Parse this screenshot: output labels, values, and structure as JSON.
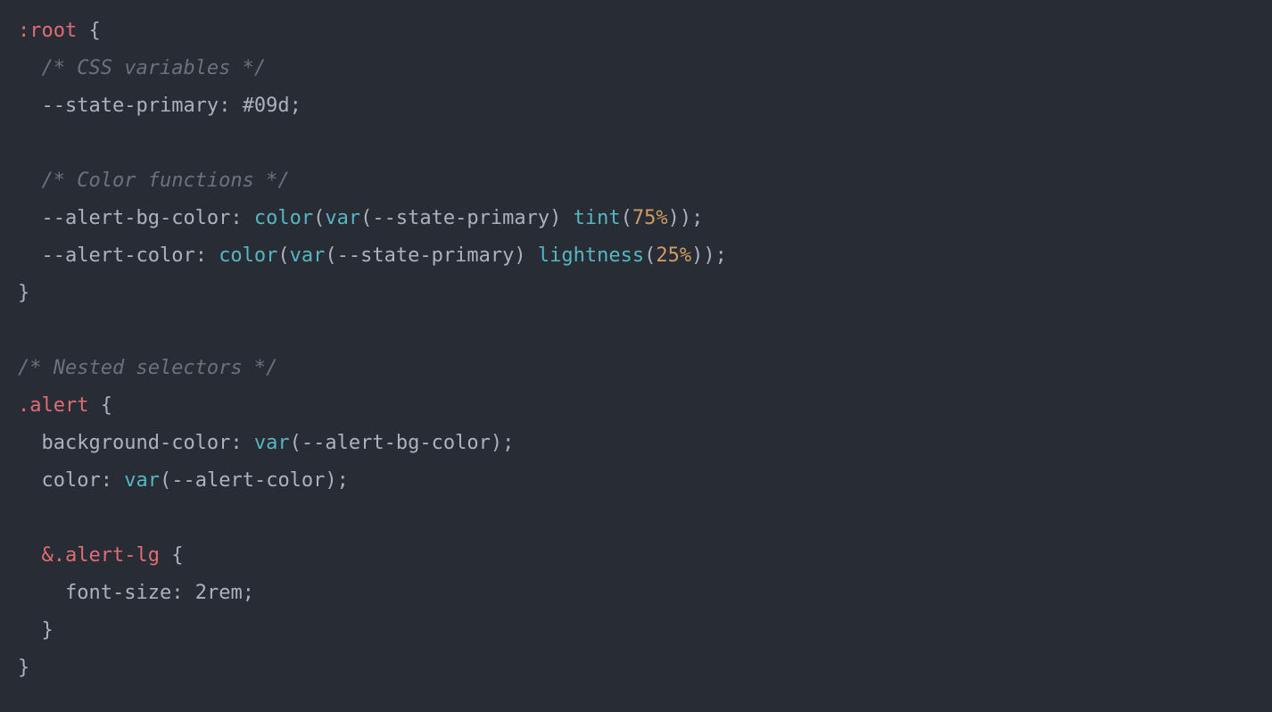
{
  "code": {
    "l1_root": ":root",
    "l1_space": " ",
    "l1_brace": "{",
    "l2_indent": "  ",
    "l2_comment": "/* CSS variables */",
    "l3_indent": "  ",
    "l3_prop": "--state-primary",
    "l3_colon": ": ",
    "l3_value": "#09d",
    "l3_semi": ";",
    "l4_blank": "",
    "l5_indent": "  ",
    "l5_comment": "/* Color functions */",
    "l6_indent": "  ",
    "l6_prop": "--alert-bg-color",
    "l6_colon": ": ",
    "l6_fn_color": "color",
    "l6_p1_open": "(",
    "l6_fn_var": "var",
    "l6_p2_open": "(",
    "l6_varname": "--state-primary",
    "l6_p2_close": ")",
    "l6_space": " ",
    "l6_fn_tint": "tint",
    "l6_p3_open": "(",
    "l6_num": "75%",
    "l6_p3_close": ")",
    "l6_p1_close": ")",
    "l6_semi": ";",
    "l7_indent": "  ",
    "l7_prop": "--alert-color",
    "l7_colon": ": ",
    "l7_fn_color": "color",
    "l7_p1_open": "(",
    "l7_fn_var": "var",
    "l7_p2_open": "(",
    "l7_varname": "--state-primary",
    "l7_p2_close": ")",
    "l7_space": " ",
    "l7_fn_light": "lightness",
    "l7_p3_open": "(",
    "l7_num": "25%",
    "l7_p3_close": ")",
    "l7_p1_close": ")",
    "l7_semi": ";",
    "l8_brace": "}",
    "l9_blank": "",
    "l10_comment": "/* Nested selectors */",
    "l11_dot": ".",
    "l11_sel": "alert",
    "l11_space": " ",
    "l11_brace": "{",
    "l12_indent": "  ",
    "l12_prop": "background-color",
    "l12_colon": ": ",
    "l12_fn_var": "var",
    "l12_p_open": "(",
    "l12_varname": "--alert-bg-color",
    "l12_p_close": ")",
    "l12_semi": ";",
    "l13_indent": "  ",
    "l13_prop": "color",
    "l13_colon": ": ",
    "l13_fn_var": "var",
    "l13_p_open": "(",
    "l13_varname": "--alert-color",
    "l13_p_close": ")",
    "l13_semi": ";",
    "l14_blank": "",
    "l15_indent": "  ",
    "l15_amp": "&",
    "l15_dot": ".",
    "l15_sel": "alert-lg",
    "l15_space": " ",
    "l15_brace": "{",
    "l16_indent": "    ",
    "l16_prop": "font-size",
    "l16_colon": ": ",
    "l16_value": "2rem",
    "l16_semi": ";",
    "l17_indent": "  ",
    "l17_brace": "}",
    "l18_brace": "}"
  }
}
